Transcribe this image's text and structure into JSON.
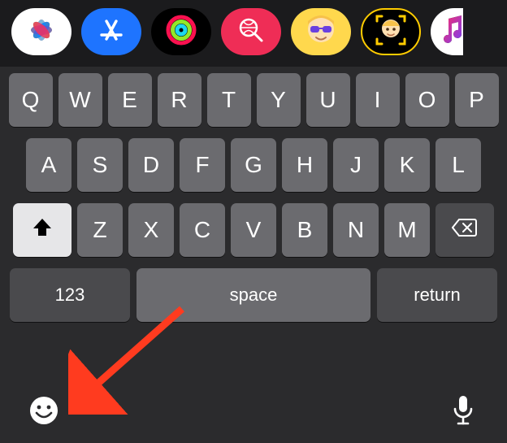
{
  "app_tray": {
    "items": [
      {
        "name": "photos"
      },
      {
        "name": "app-store"
      },
      {
        "name": "activity"
      },
      {
        "name": "find"
      },
      {
        "name": "memoji-sunglasses"
      },
      {
        "name": "memoji-editor"
      },
      {
        "name": "music"
      }
    ]
  },
  "keyboard": {
    "row1": [
      "Q",
      "W",
      "E",
      "R",
      "T",
      "Y",
      "U",
      "I",
      "O",
      "P"
    ],
    "row2": [
      "A",
      "S",
      "D",
      "F",
      "G",
      "H",
      "J",
      "K",
      "L"
    ],
    "row3": [
      "Z",
      "X",
      "C",
      "V",
      "B",
      "N",
      "M"
    ],
    "numbers_label": "123",
    "space_label": "space",
    "return_label": "return"
  },
  "annotation": {
    "arrow_color": "#ff3b1f"
  }
}
